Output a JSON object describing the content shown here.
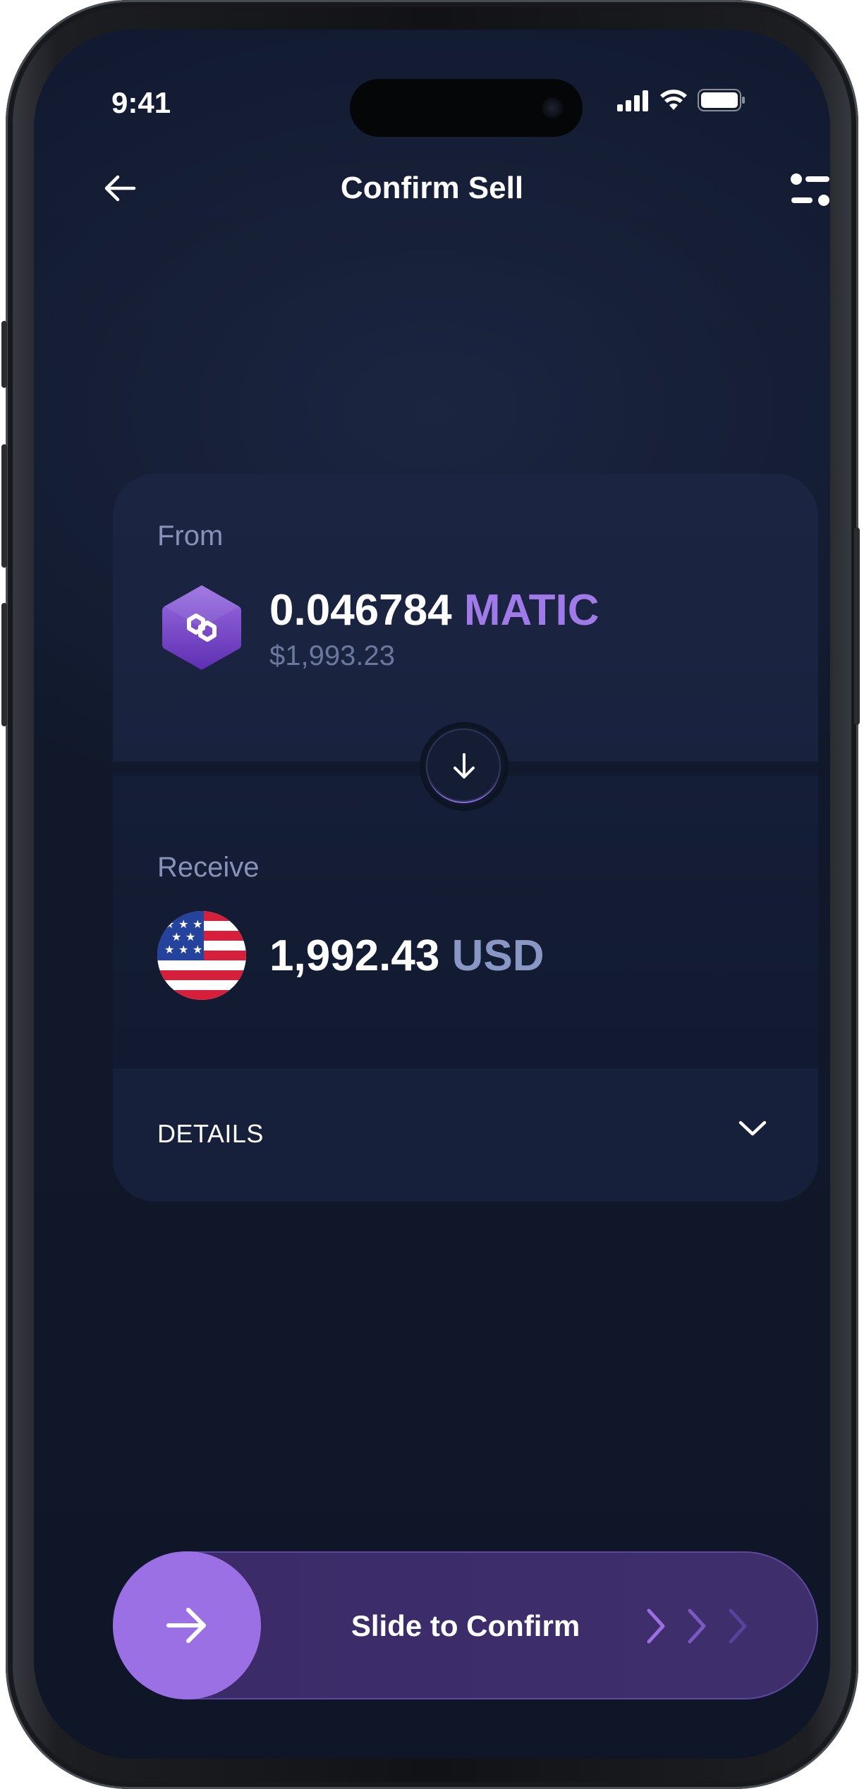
{
  "status_bar": {
    "time": "9:41"
  },
  "header": {
    "title": "Confirm Sell"
  },
  "from": {
    "label": "From",
    "amount": "0.046784",
    "symbol": "MATIC",
    "fiat_value": "$1,993.23",
    "token_icon": "polygon-icon"
  },
  "receive": {
    "label": "Receive",
    "amount": "1,992.43",
    "currency": "USD",
    "flag_icon": "us-flag-icon"
  },
  "details": {
    "label": "DETAILS"
  },
  "confirm": {
    "label": "Slide to Confirm"
  },
  "colors": {
    "accent": "#9b70e4",
    "background": "#101829",
    "card": "#1b2542",
    "muted_text": "#8892b8"
  }
}
